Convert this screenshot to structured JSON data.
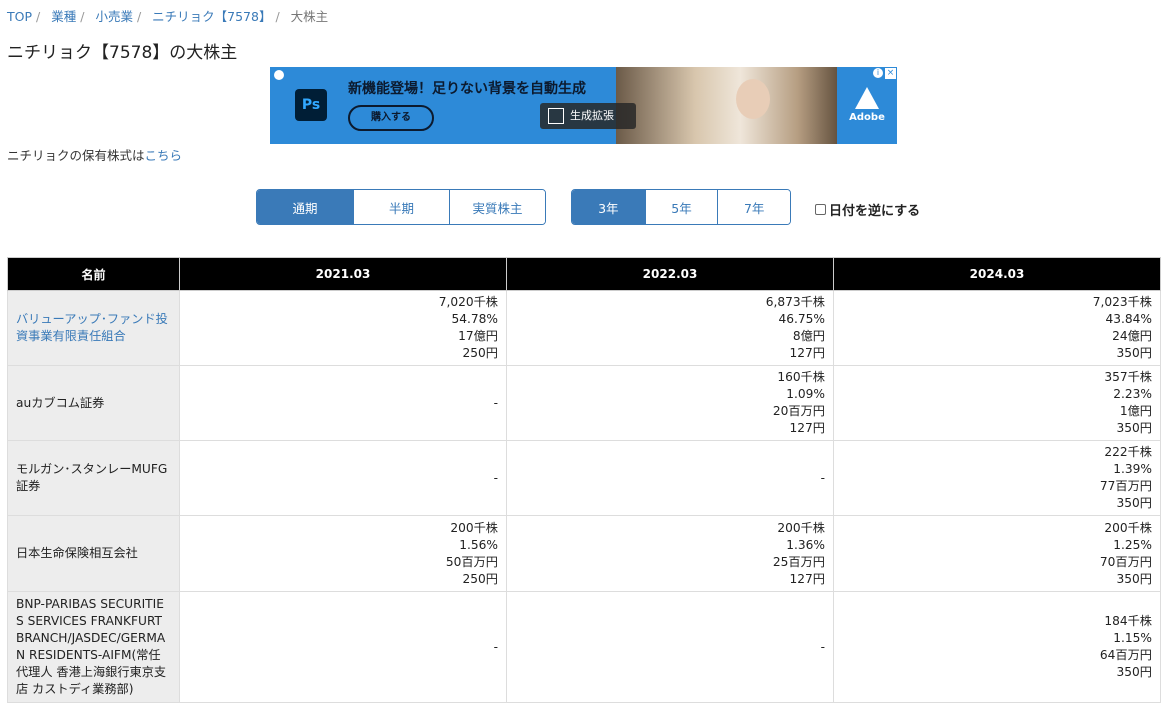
{
  "breadcrumb": {
    "items": [
      "TOP",
      "業種",
      "小売業",
      "ニチリョク【7578】"
    ],
    "current": "大株主"
  },
  "title": "ニチリョク【7578】の大株主",
  "ad": {
    "headline": "新機能登場！足りない背景を自動生成",
    "button": "購入する",
    "generate": "生成拡張",
    "ps": "Ps",
    "brand": "Adobe"
  },
  "holdings": {
    "text": "ニチリョクの保有株式は",
    "link": "こちら"
  },
  "period_tabs": [
    {
      "label": "通期",
      "active": true
    },
    {
      "label": "半期",
      "active": false
    },
    {
      "label": "実質株主",
      "active": false
    }
  ],
  "year_tabs": [
    {
      "label": "3年",
      "active": true
    },
    {
      "label": "5年",
      "active": false
    },
    {
      "label": "7年",
      "active": false
    }
  ],
  "reverse_label": "日付を逆にする",
  "table": {
    "headers": [
      "名前",
      "2021.03",
      "2022.03",
      "2024.03"
    ],
    "rows": [
      {
        "name": "バリューアップ･ファンド投資事業有限責任組合",
        "link": true,
        "cells": [
          [
            "7,020千株",
            "54.78%",
            "17億円",
            "250円"
          ],
          [
            "6,873千株",
            "46.75%",
            "8億円",
            "127円"
          ],
          [
            "7,023千株",
            "43.84%",
            "24億円",
            "350円"
          ]
        ]
      },
      {
        "name": "auカブコム証券",
        "link": false,
        "cells": [
          [
            "-"
          ],
          [
            "160千株",
            "1.09%",
            "20百万円",
            "127円"
          ],
          [
            "357千株",
            "2.23%",
            "1億円",
            "350円"
          ]
        ]
      },
      {
        "name": "モルガン･スタンレーMUFG証券",
        "link": false,
        "cells": [
          [
            "-"
          ],
          [
            "-"
          ],
          [
            "222千株",
            "1.39%",
            "77百万円",
            "350円"
          ]
        ]
      },
      {
        "name": "日本生命保険相互会社",
        "link": false,
        "cells": [
          [
            "200千株",
            "1.56%",
            "50百万円",
            "250円"
          ],
          [
            "200千株",
            "1.36%",
            "25百万円",
            "127円"
          ],
          [
            "200千株",
            "1.25%",
            "70百万円",
            "350円"
          ]
        ]
      },
      {
        "name": "BNP-PARIBAS SECURITIES SERVICES FRANKFURT BRANCH/JASDEC/GERMAN RESIDENTS-AIFM(常任代理人 香港上海銀行東京支店 カストディ業務部)",
        "link": false,
        "cells": [
          [
            "-"
          ],
          [
            "-"
          ],
          [
            "184千株",
            "1.15%",
            "64百万円",
            "350円"
          ]
        ]
      }
    ]
  }
}
